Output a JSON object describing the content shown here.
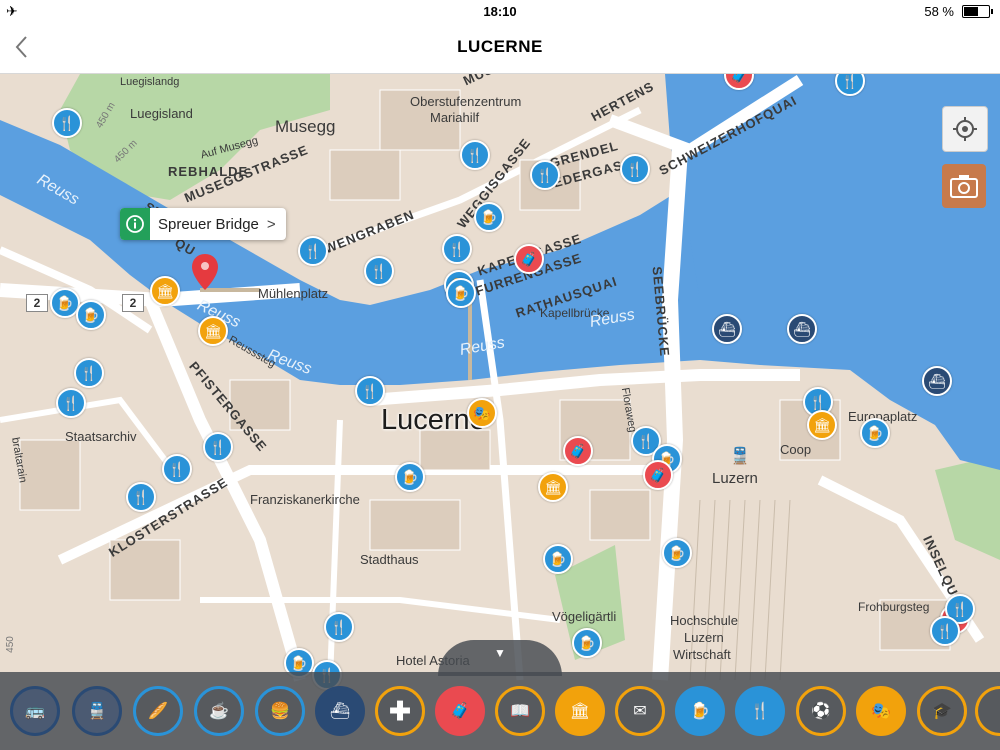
{
  "status_bar": {
    "time": "18:10",
    "battery": "58 %"
  },
  "header": {
    "title": "LUCERNE"
  },
  "callout": {
    "label": "Spreuer Bridge"
  },
  "map": {
    "city_label": "Lucerne",
    "road_number_a": "2",
    "road_number_b": "2",
    "labels": {
      "luegisland": "Luegisland",
      "luegislandg": "Luegislandg",
      "museggstrasse_part": "MUSE",
      "oberstufenzentrum": "Oberstufenzentrum",
      "mariahilf": "Mariahilf",
      "musegg": "Musegg",
      "auf_musegg": "Auf Musegg",
      "rebhalde": "REBHALDE",
      "museggstrasse": "MUSEGGSTRASSE",
      "hertenstein": "HERTENS",
      "schweizerhofquai": "SCHWEIZERHOFQUAI",
      "grendel": "GRENDEL",
      "ledergasse": "LEDERGASSE",
      "weggisgasse": "WEGGISGASSE",
      "wengraben": "WENGRABEN",
      "kapellgasse": "KAPELLGASSE",
      "furrengasse": "FURRENGASSE",
      "rathausquai": "RATHAUSQUAI",
      "kapellbruecke": "Kapellbrücke",
      "seebruecke": "SEEBRÜCKE",
      "muehlenplatz": "Mühlenplatz",
      "pfistergasse": "PFISTERGASSE",
      "reusssteg": "Reusssteg",
      "staatsarchiv": "Staatsarchiv",
      "franziskanerkirche": "Franziskanerkirche",
      "klosterstrasse": "KLOSTERSTRASSE",
      "stadthaus": "Stadthaus",
      "floraweg": "Floraweg",
      "luzern": "Luzern",
      "coop": "Coop",
      "europaplatz": "Europaplatz",
      "inselquai": "INSELQUAI",
      "voegeligaertli": "Vögeligärtli",
      "hochschule": "Hochschule",
      "hochschule_luzern": "Luzern",
      "wirtschaft": "Wirtschaft",
      "frohburgsteg": "Frohburgsteg",
      "hotel_astoria": "Hotel Astoria",
      "elevation_450": "450 m",
      "elevation_450b": "450 m",
      "elevation_450c": "450",
      "abraltarain": "bralta­rain",
      "st_part": "ST",
      "qu_part": "QU"
    },
    "water_labels": {
      "reuss_nw": "Reuss",
      "reuss_a": "Reuss",
      "reuss_b": "Reuss",
      "reuss_c": "Reuss",
      "reuss_d": "Reuss"
    }
  },
  "category_bar": {
    "items": [
      "bus",
      "train",
      "bakery",
      "cafe",
      "fast-food",
      "ferry",
      "pharmacy",
      "luggage",
      "books",
      "museum",
      "post",
      "pub",
      "restaurant",
      "sports",
      "theatre",
      "education",
      "more"
    ]
  },
  "colors": {
    "water": "#5b9fe0",
    "land": "#e9ddd0",
    "park": "#b7d7a6",
    "restaurant": "#2a93d8",
    "museum": "#f2a20c",
    "shopping": "#ea4a50",
    "ferry": "#2a4a74"
  }
}
